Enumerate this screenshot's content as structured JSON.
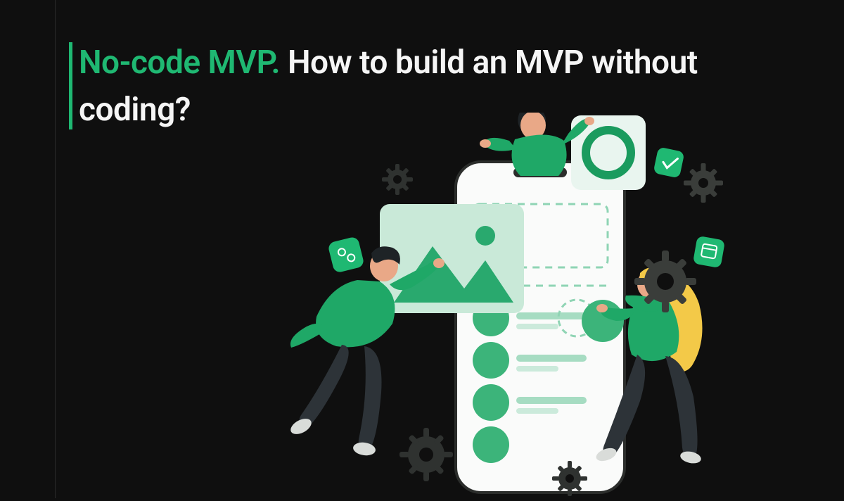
{
  "heading": {
    "accent": "No-code MVP.",
    "rest": " How to build an MVP without coding?"
  },
  "colors": {
    "accent": "#1fb872",
    "background": "#0f0f0f",
    "text": "#f5f5f5"
  },
  "illustration": {
    "description": "three-people-building-mobile-app-ui",
    "elements": [
      "phone-mockup",
      "image-placeholder-card",
      "circle-card",
      "list-items",
      "gear-icons",
      "check-badge",
      "calendar-badge",
      "settings-badge"
    ]
  }
}
